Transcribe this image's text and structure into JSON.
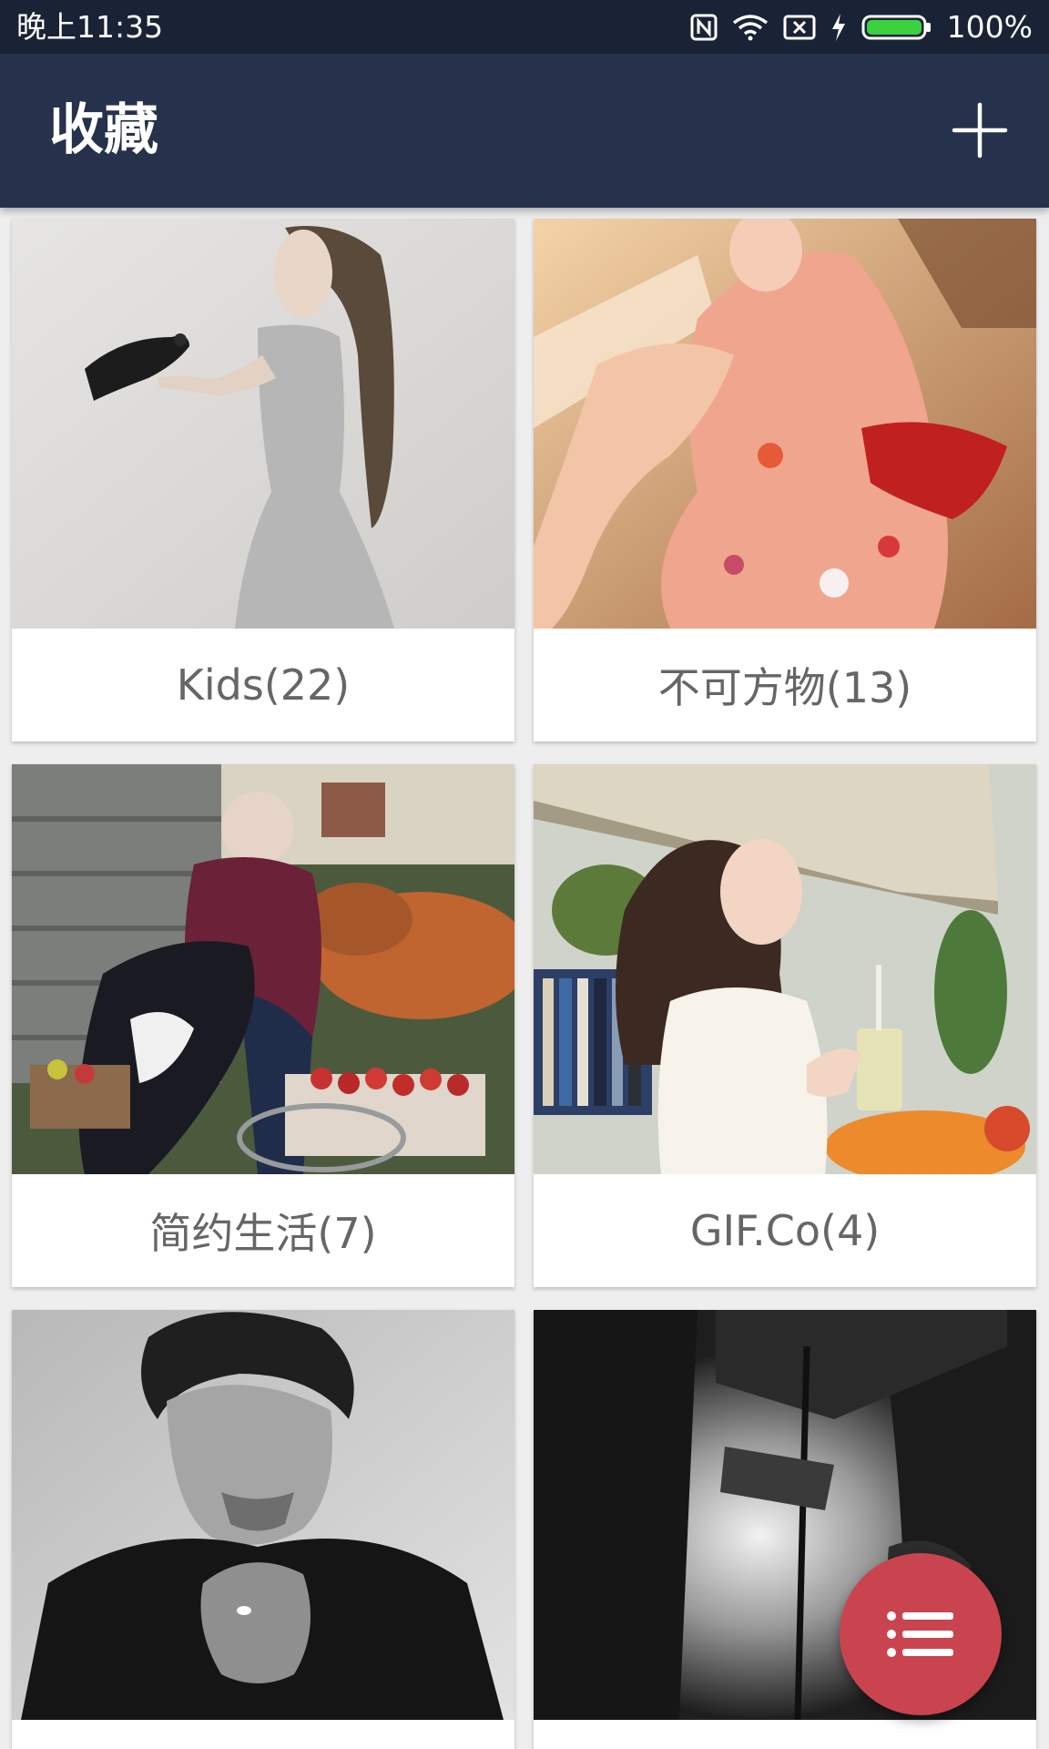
{
  "status_bar": {
    "time": "晚上11:35",
    "battery_percent": "100%",
    "icons": [
      "nfc-icon",
      "wifi-icon",
      "no-sim-icon",
      "charging-icon",
      "battery-icon"
    ]
  },
  "app_bar": {
    "title": "收藏",
    "action_icon": "add-icon"
  },
  "collections": [
    {
      "label": "Kids(22)",
      "image": "girl-holding-bird-photo"
    },
    {
      "label": "不可方物(13)",
      "image": "girl-in-pink-kimono-photo"
    },
    {
      "label": "简约生活(7)",
      "image": "old-woman-with-dog-and-apples-photo"
    },
    {
      "label": "GIF.Co(4)",
      "image": "woman-with-drink-at-market-photo"
    },
    {
      "label": "",
      "image": "man-in-black-portrait-photo"
    },
    {
      "label": "",
      "image": "dark-alley-photo"
    }
  ],
  "fab": {
    "icon": "list-icon"
  },
  "colors": {
    "status_bar_bg": "#1a2236",
    "app_bar_bg": "#26314c",
    "page_bg": "#eeeeee",
    "card_label_text": "#666666",
    "fab_bg": "#c9444e"
  }
}
